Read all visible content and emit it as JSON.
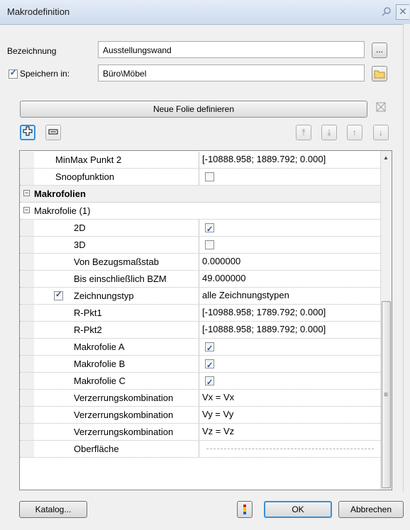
{
  "window": {
    "title": "Makrodefinition"
  },
  "form": {
    "bezeichnung_label": "Bezeichnung",
    "bezeichnung_value": "Ausstellungswand",
    "browse_label": "...",
    "speichern_label": "Speichern in:",
    "speichern_checked": true,
    "speichern_value": "Büro\\Möbel",
    "neue_folie_label": "Neue Folie definieren"
  },
  "grid": {
    "rows": [
      {
        "name": "MinMax Punkt 2",
        "value": "[-10888.958; 1889.792; 0.000]"
      },
      {
        "name": "Snoopfunktion",
        "check": false
      },
      {
        "name": "Makrofolien",
        "section": true
      },
      {
        "name": "Makrofolie (1)",
        "subsection": true
      },
      {
        "name": "2D",
        "check": true
      },
      {
        "name": "3D",
        "check": false
      },
      {
        "name": "Von Bezugsmaßstab",
        "value": "0.000000"
      },
      {
        "name": "Bis einschließlich BZM",
        "value": "49.000000"
      },
      {
        "name": "Zeichnungstyp",
        "value": "alle Zeichnungstypen",
        "name_check": true
      },
      {
        "name": "R-Pkt1",
        "value": "[-10988.958; 1789.792; 0.000]"
      },
      {
        "name": "R-Pkt2",
        "value": "[-10888.958; 1889.792; 0.000]"
      },
      {
        "name": "Makrofolie A",
        "check": true
      },
      {
        "name": "Makrofolie B",
        "check": true
      },
      {
        "name": "Makrofolie C",
        "check": true
      },
      {
        "name": "Verzerrungskombination",
        "value": "Vx = Vx"
      },
      {
        "name": "Verzerrungskombination",
        "value": "Vy = Vy"
      },
      {
        "name": "Verzerrungskombination",
        "value": "Vz = Vz"
      },
      {
        "name": "Oberfläche",
        "value": ""
      }
    ]
  },
  "footer": {
    "katalog_label": "Katalog...",
    "ok_label": "OK",
    "abbrechen_label": "Abbrechen"
  }
}
